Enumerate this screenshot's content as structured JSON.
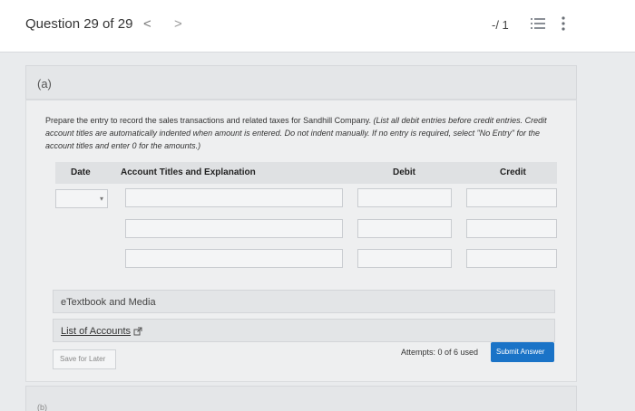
{
  "header": {
    "question_label": "Question 29 of 29",
    "prev_icon": "<",
    "next_icon": ">",
    "score": "-/ 1",
    "list_icon": "list-icon",
    "menu_icon": "kebab-icon"
  },
  "part_a": {
    "label": "(a)"
  },
  "instructions": {
    "plain": "Prepare the entry to record the sales transactions and related taxes for Sandhill Company. ",
    "italic": "(List all debit entries before credit entries. Credit account titles are automatically indented when amount is entered. Do not indent manually. If no entry is required, select \"No Entry\" for the account titles and enter 0 for the amounts.)"
  },
  "table": {
    "headers": {
      "date": "Date",
      "account": "Account Titles and Explanation",
      "debit": "Debit",
      "credit": "Credit"
    },
    "rows": [
      {
        "date": "",
        "account": "",
        "debit": "",
        "credit": ""
      },
      {
        "account": "",
        "debit": "",
        "credit": ""
      },
      {
        "account": "",
        "debit": "",
        "credit": ""
      }
    ]
  },
  "resources": {
    "etextbook": "eTextbook and Media",
    "list_of_accounts": "List of Accounts"
  },
  "footer": {
    "save_label": "Save for Later",
    "attempts": "Attempts: 0 of 6 used",
    "submit_label": "Submit Answer"
  },
  "part_b": {
    "label": "(b)"
  },
  "colors": {
    "accent": "#1a73c7",
    "page_bg": "#e9ebed",
    "card_bg": "#eeeff0"
  }
}
